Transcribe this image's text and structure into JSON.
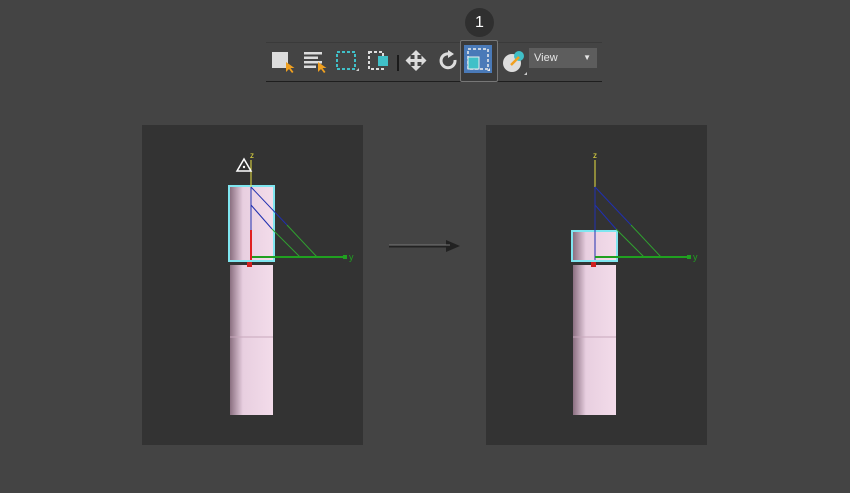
{
  "step_badge": "1",
  "toolbar": {
    "items": [
      {
        "name": "select-object",
        "icon": "select-object-icon"
      },
      {
        "name": "select-by-name",
        "icon": "select-by-name-icon"
      },
      {
        "name": "rectangular-selection-region",
        "icon": "rect-selection-icon"
      },
      {
        "name": "window-crossing",
        "icon": "window-crossing-icon"
      },
      {
        "name": "select-and-move",
        "icon": "move-icon"
      },
      {
        "name": "select-and-rotate",
        "icon": "rotate-icon"
      },
      {
        "name": "select-and-scale",
        "icon": "scale-icon",
        "active": true
      },
      {
        "name": "reference-coordinate",
        "icon": "pick-icon"
      }
    ],
    "coord_dropdown": "View"
  },
  "viewports": {
    "axis_z": "z",
    "axis_y": "y"
  },
  "colors": {
    "accent": "#4a7ab8",
    "selection": "#7fe6f0",
    "object": "#e8c8dc"
  }
}
